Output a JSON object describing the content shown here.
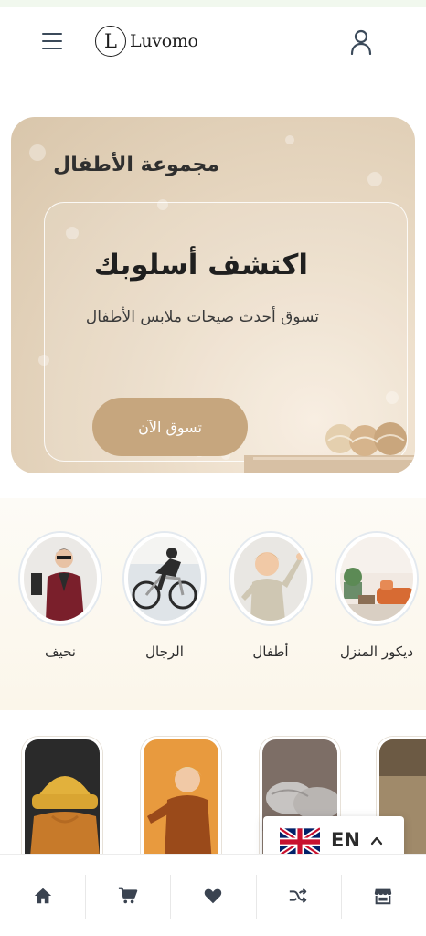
{
  "header": {
    "logo_letter": "L",
    "brand_name": "Luvomo"
  },
  "hero": {
    "collection_title": "مجموعة الأطفال",
    "heading": "اكتشف أسلوبك",
    "subtitle": "تسوق أحدث صيحات ملابس الأطفال",
    "cta_label": "تسوق الآن"
  },
  "categories": [
    {
      "label": "ديكور المنزل",
      "icon": "home-decor-image"
    },
    {
      "label": "أطفال",
      "icon": "kids-image"
    },
    {
      "label": "الرجال",
      "icon": "men-cyclist-image"
    },
    {
      "label": "نحيف",
      "icon": "slim-fashion-image"
    }
  ],
  "language": {
    "code": "EN",
    "flag": "uk-flag-icon"
  },
  "bottom_nav": [
    {
      "name": "home",
      "icon": "home-icon"
    },
    {
      "name": "cart",
      "icon": "cart-icon"
    },
    {
      "name": "wishlist",
      "icon": "heart-icon"
    },
    {
      "name": "compare",
      "icon": "shuffle-icon"
    },
    {
      "name": "store",
      "icon": "store-icon"
    }
  ],
  "colors": {
    "accent": "#c6a67e",
    "icon": "#3b4a5a",
    "nav_icon": "#3a4350"
  }
}
